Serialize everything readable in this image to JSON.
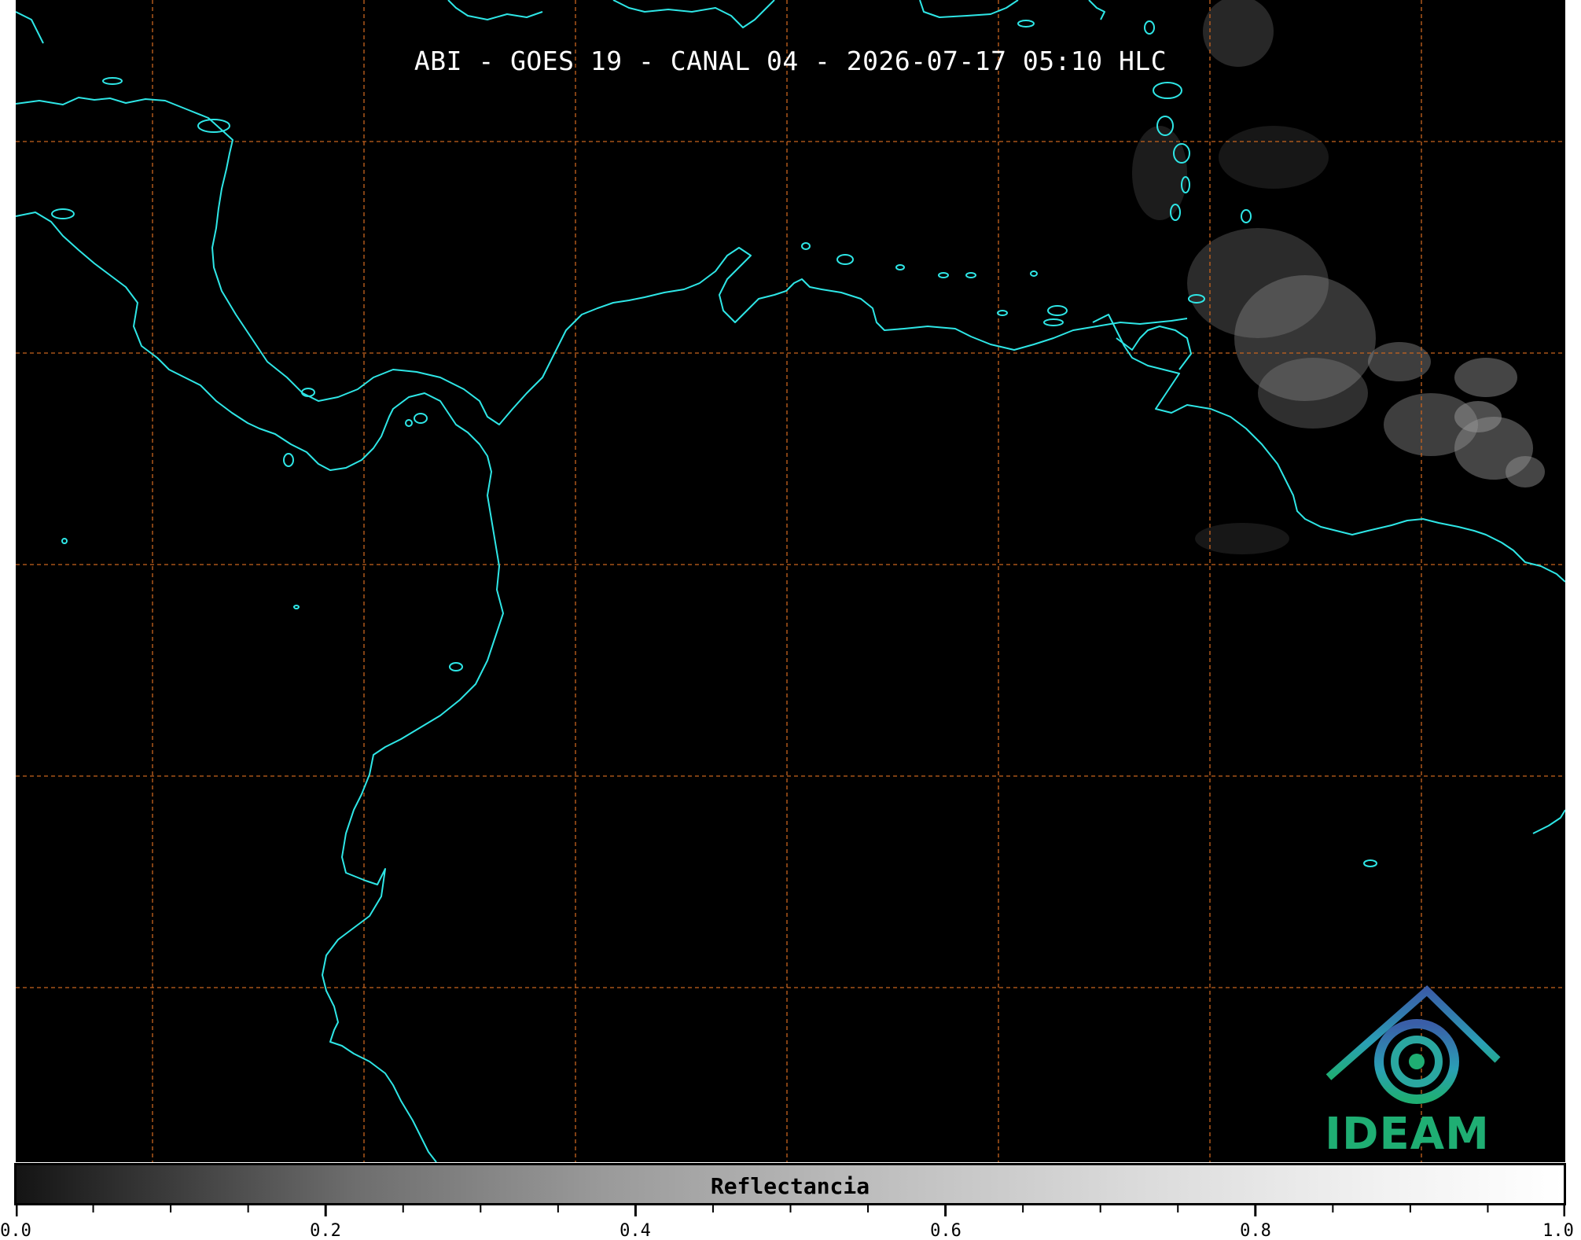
{
  "map": {
    "title": "ABI - GOES 19 - CANAL 04 - 2026-07-17 05:10 HLC",
    "background_color": "#000000",
    "coastline_color": "#2ee6e6",
    "gridline_color": "#c8641e",
    "cloud_color": "#8a8a8a"
  },
  "colorbar": {
    "label": "Reflectancia",
    "min": 0.0,
    "max": 1.0,
    "tick_labels": [
      "0.0",
      "0.2",
      "0.4",
      "0.6",
      "0.8",
      "1.0"
    ],
    "gradient_from": "#141414",
    "gradient_to": "#ffffff"
  },
  "logo": {
    "text": "IDEAM",
    "text_color": "#1fae73",
    "icon": "ideam-logo-icon"
  }
}
